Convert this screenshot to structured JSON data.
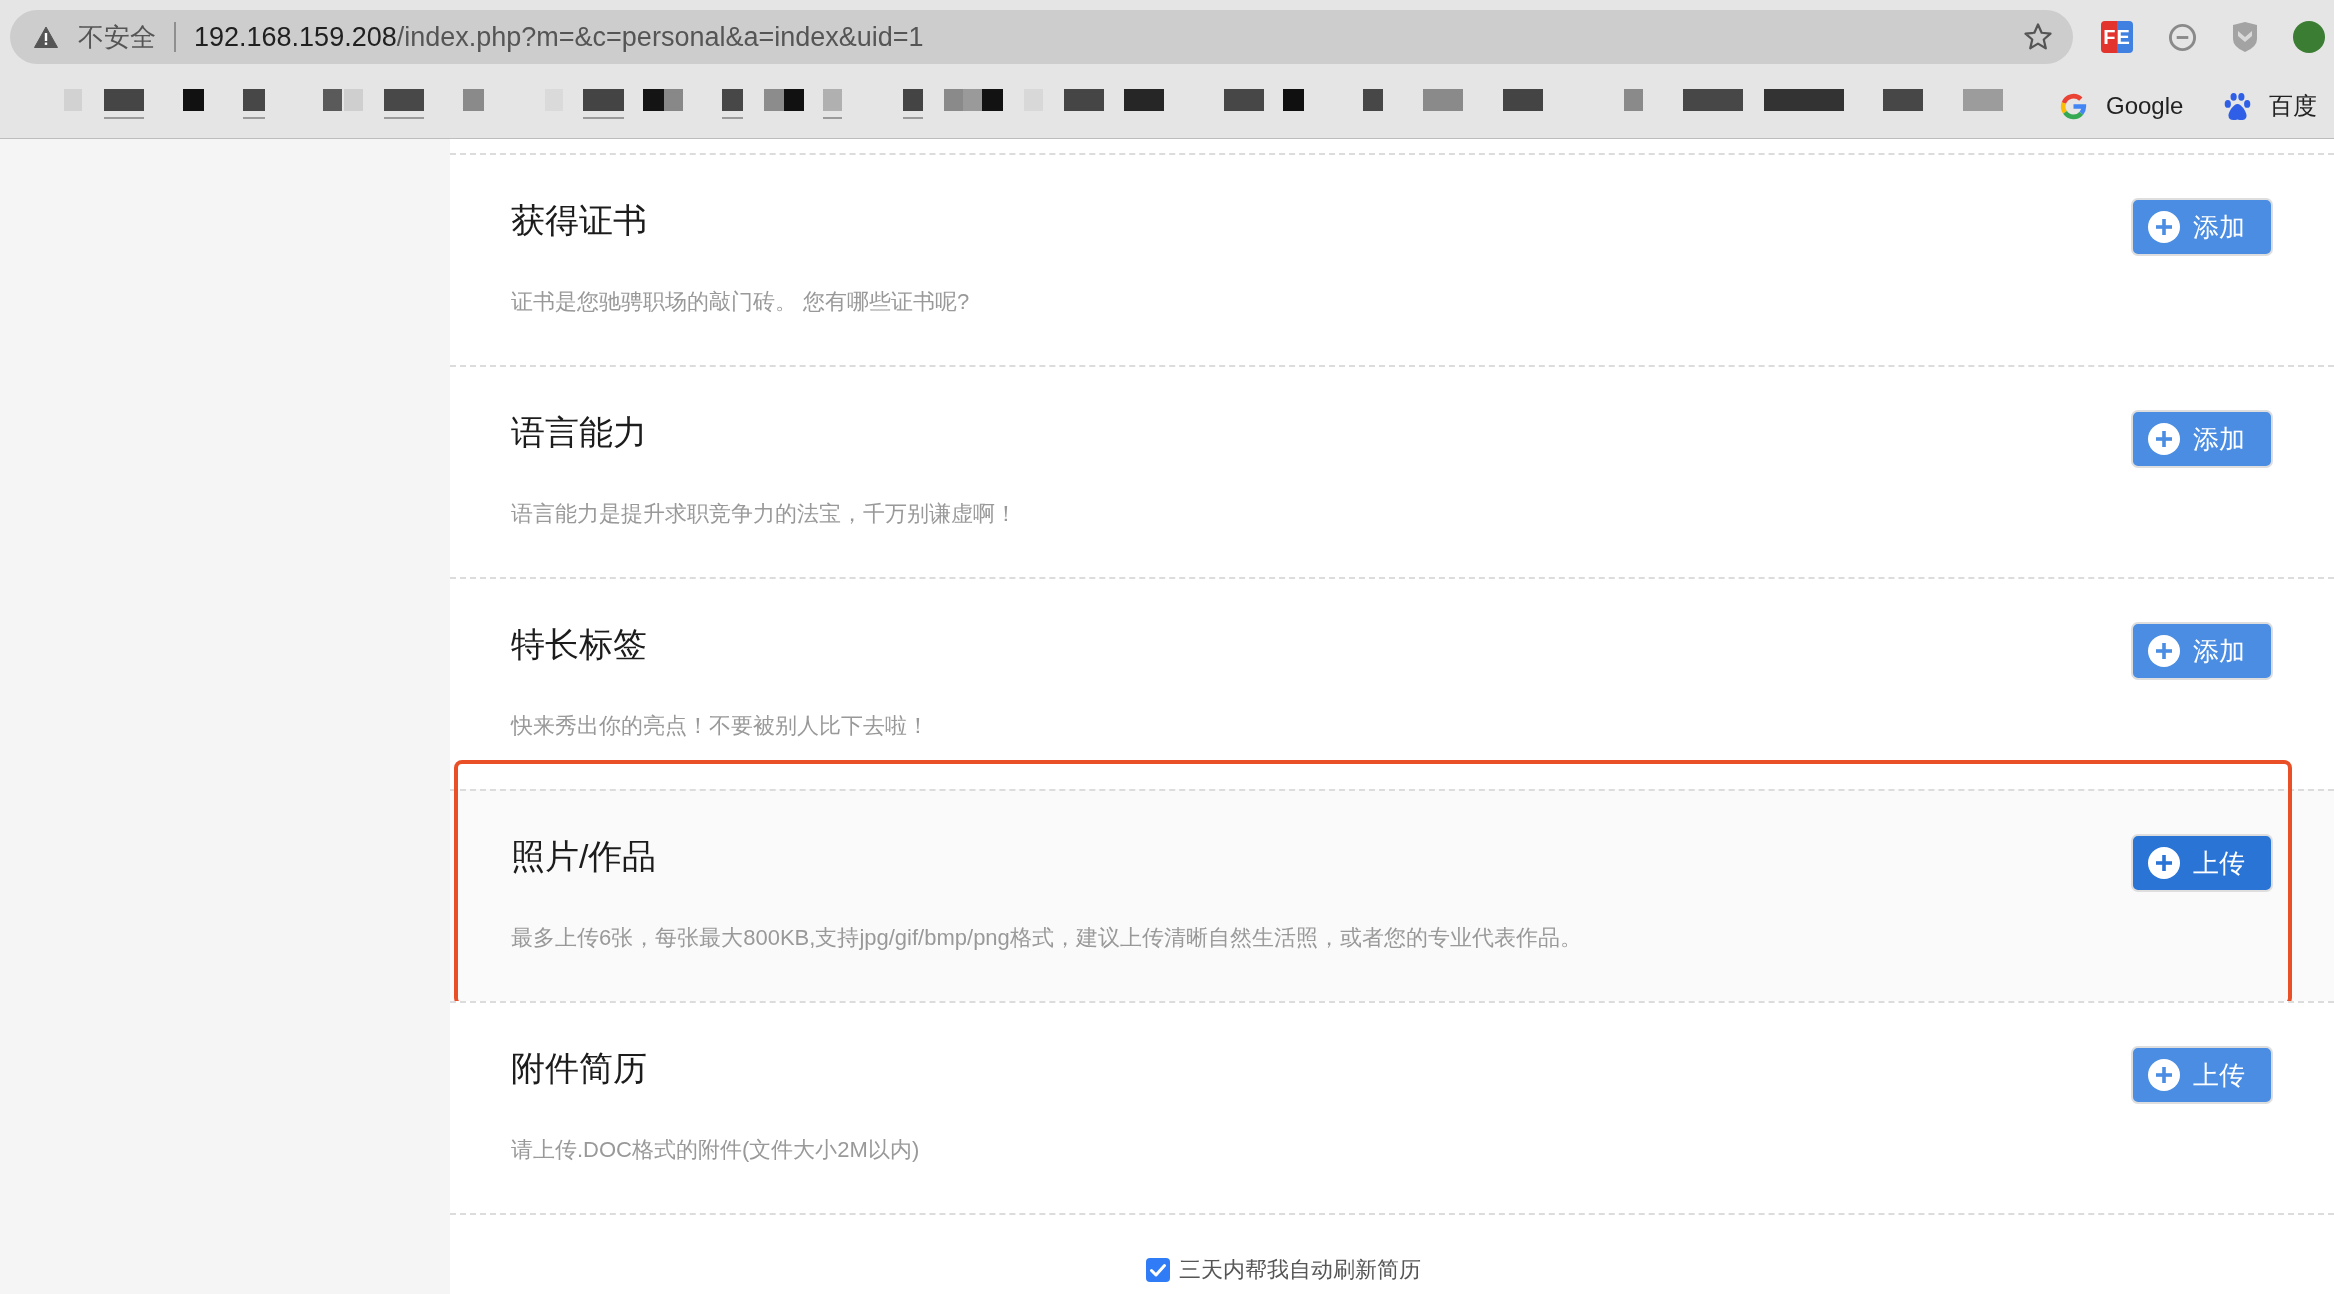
{
  "browser": {
    "security_label": "不安全",
    "url": {
      "host": "192.168.159.208",
      "path": "/index.php?m=&c=personal&a=index&uid=1"
    },
    "bookmarked": false,
    "extensions": [
      {
        "kind": "badge",
        "label": "FE"
      },
      {
        "kind": "minus-circle"
      },
      {
        "kind": "shield"
      },
      {
        "kind": "avatar"
      }
    ],
    "bookmarks": [
      {
        "kind": "google",
        "label": "Google"
      },
      {
        "kind": "baidu",
        "label": "百度"
      }
    ]
  },
  "sections": [
    {
      "title": "获得证书",
      "description": "证书是您驰骋职场的敲门砖。 您有哪些证书呢?",
      "button": "添加",
      "hovered": false,
      "marked": false
    },
    {
      "title": "语言能力",
      "description": "语言能力是提升求职竞争力的法宝，千万别谦虚啊！",
      "button": "添加",
      "hovered": false,
      "marked": false
    },
    {
      "title": "特长标签",
      "description": "快来秀出你的亮点！不要被别人比下去啦！",
      "button": "添加",
      "hovered": false,
      "marked": false
    },
    {
      "title": "照片/作品",
      "description": "最多上传6张，每张最大800KB,支持jpg/gif/bmp/png格式，建议上传清晰自然生活照，或者您的专业代表作品。",
      "button": "上传",
      "hovered": true,
      "marked": true
    },
    {
      "title": "附件简历",
      "description": "请上传.DOC格式的附件(文件大小2M以内)",
      "button": "上传",
      "hovered": false,
      "marked": false
    }
  ],
  "auto_refresh": {
    "label": "三天内帮我自动刷新简历",
    "checked": true
  }
}
